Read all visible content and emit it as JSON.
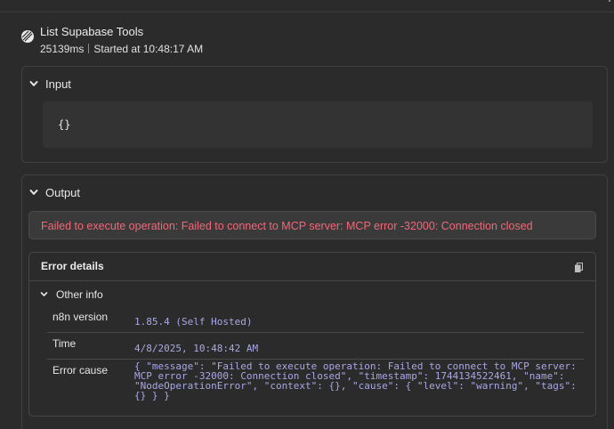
{
  "tool": {
    "title": "List Supabase Tools",
    "duration": "25139ms",
    "started": "Started at 10:48:17 AM",
    "icon": "supabase-icon"
  },
  "input": {
    "label": "Input",
    "json": "{}"
  },
  "output": {
    "label": "Output",
    "error_message": "Failed to execute operation: Failed to connect to MCP server: MCP error -32000: Connection closed",
    "details": {
      "title": "Error details",
      "copy_icon": "copy-icon",
      "other_info_label": "Other info",
      "rows": [
        {
          "label": "n8n version",
          "value": "1.85.4 (Self Hosted)"
        },
        {
          "label": "Time",
          "value": "4/8/2025, 10:48:42 AM"
        },
        {
          "label": "Error cause",
          "value_lines": [
            "{ \"message\": \"Failed to execute operation: Failed to connect to MCP server:",
            "MCP error -32000: Connection closed\", \"timestamp\": 1744134522461, \"name\":",
            "\"NodeOperationError\", \"context\": {}, \"cause\": { \"level\": \"warning\", \"tags\":",
            "{} } }"
          ]
        }
      ]
    }
  },
  "colors": {
    "background": "#2b2b2b",
    "error_text": "#f2677a",
    "mono_value": "#a9a7e6",
    "border": "#414141"
  }
}
